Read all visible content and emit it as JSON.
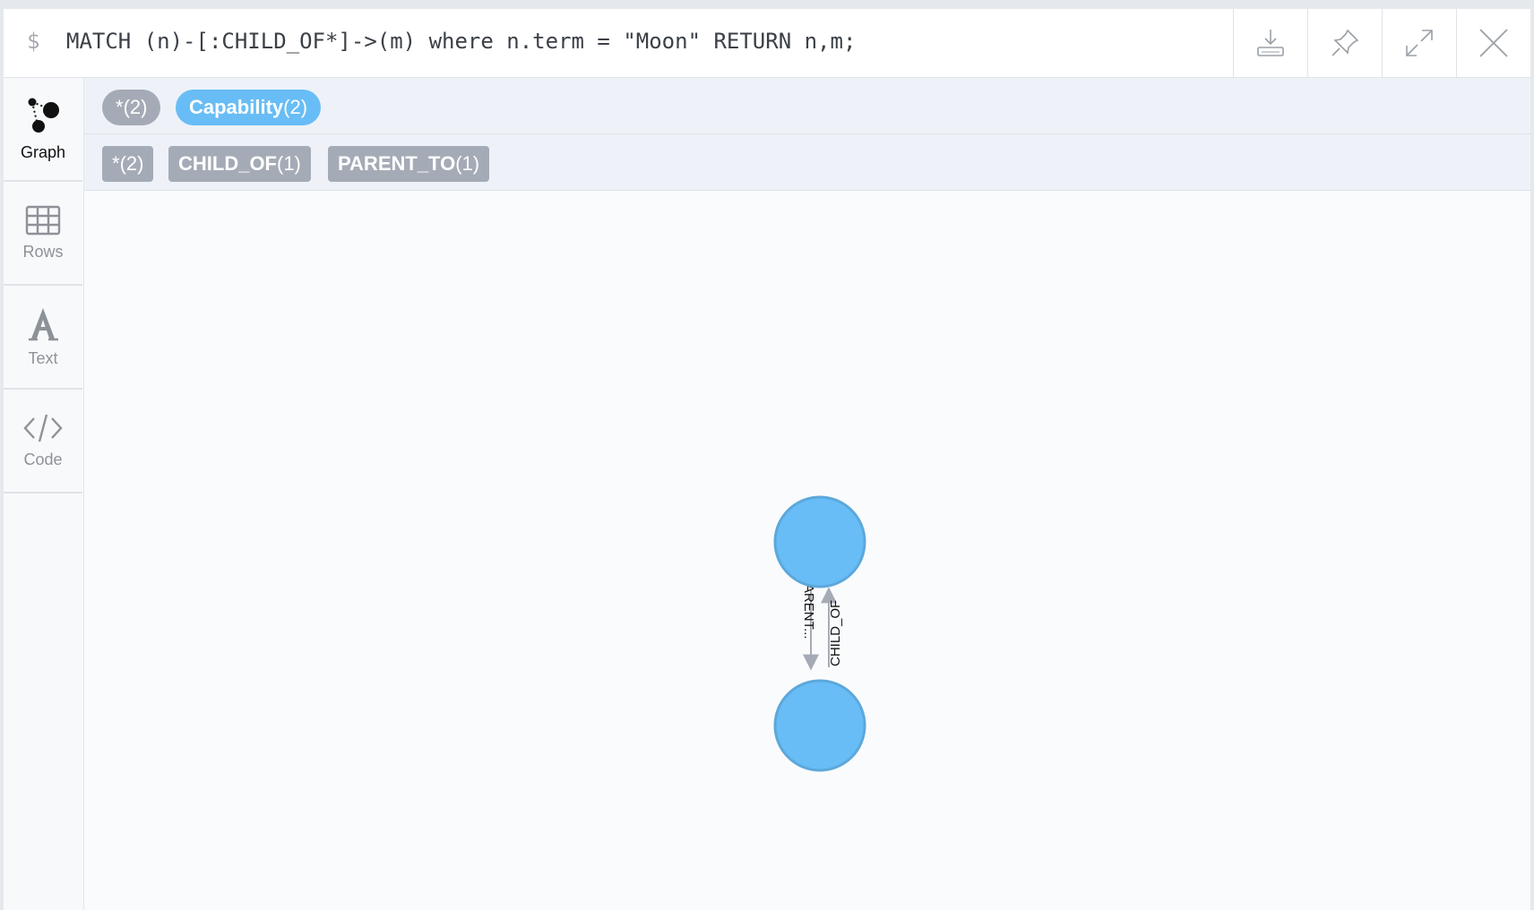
{
  "editor": {
    "prompt": "$",
    "query": "MATCH (n)-[:CHILD_OF*]->(m) where n.term = \"Moon\" RETURN n,m;"
  },
  "toolbar": {
    "actions": [
      {
        "name": "download-icon"
      },
      {
        "name": "pin-icon"
      },
      {
        "name": "expand-icon"
      },
      {
        "name": "close-icon"
      }
    ]
  },
  "sidebar": {
    "items": [
      {
        "label": "Graph",
        "icon": "graph-icon",
        "active": true
      },
      {
        "label": "Rows",
        "icon": "table-icon",
        "active": false
      },
      {
        "label": "Text",
        "icon": "text-icon",
        "active": false
      },
      {
        "label": "Code",
        "icon": "code-icon",
        "active": false
      }
    ]
  },
  "legend": {
    "labels": [
      {
        "name": "*",
        "count": "(2)",
        "color": "#a5abb6"
      },
      {
        "name": "Capability",
        "count": "(2)",
        "color": "#68bdf6"
      }
    ],
    "relationships": [
      {
        "name": "*",
        "count": "(2)",
        "color": "#a5abb6"
      },
      {
        "name": "CHILD_OF",
        "count": "(1)",
        "color": "#a5abb6"
      },
      {
        "name": "PARENT_TO",
        "count": "(1)",
        "color": "#a5abb6"
      }
    ]
  },
  "graph": {
    "node_color": "#68bdf6",
    "node_stroke": "#5ca8db",
    "edge_color": "#a5abb6",
    "edges": [
      {
        "label": "PARENT..."
      },
      {
        "label": "CHILD_OF"
      }
    ]
  }
}
